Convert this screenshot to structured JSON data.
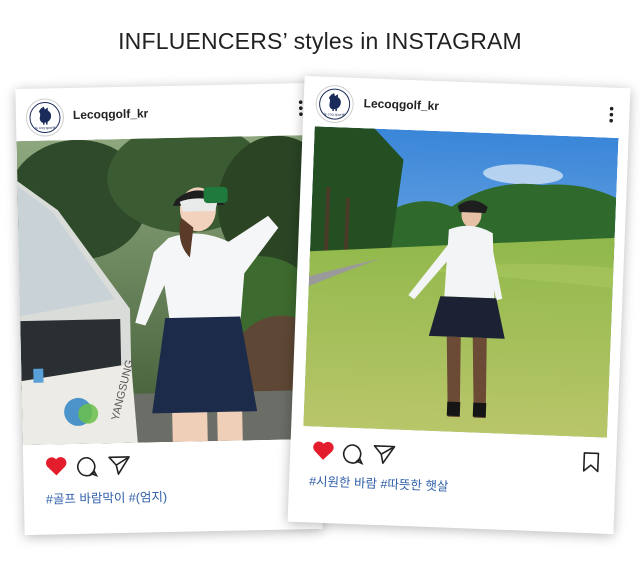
{
  "headline": "INFLUENCERS’ styles in INSTAGRAM",
  "posts": [
    {
      "username": "Lecoqgolf_kr",
      "avatar_text": "le coq sportif",
      "hashtags": "#골프 바람막이 #(엄지)",
      "liked": true,
      "bookmark_visible": false
    },
    {
      "username": "Lecoqgolf_kr",
      "avatar_text": "le coq sportif",
      "hashtags": "#시원한 바람 #따뜻한 햇살",
      "liked": true,
      "bookmark_visible": true
    }
  ],
  "photo1_text": {
    "cart_brand": "YANGSUNG"
  },
  "colors": {
    "like": "#e41d2d",
    "hashtag": "#2f5fa8"
  },
  "icons": [
    "heart-icon",
    "comment-icon",
    "share-icon",
    "bookmark-icon",
    "more-icon",
    "rooster-logo-icon"
  ]
}
